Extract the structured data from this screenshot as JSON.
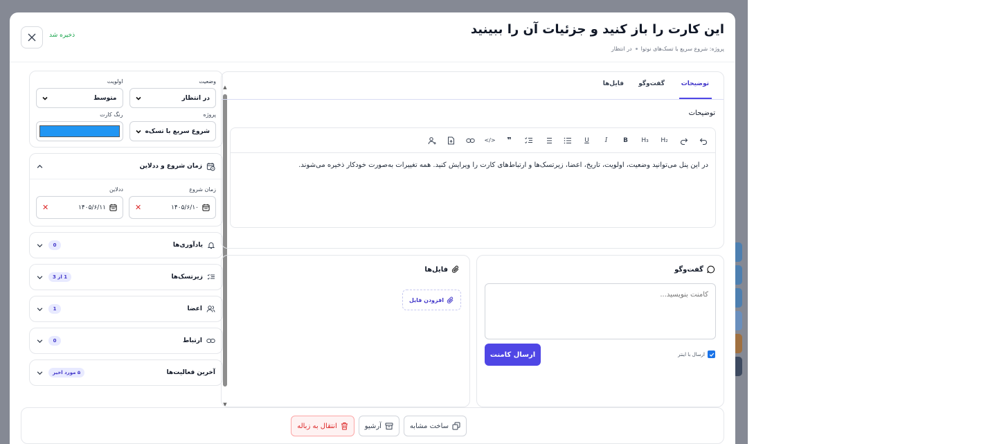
{
  "modal": {
    "title": "این کارت را باز کنید و جزئیات آن را ببینید",
    "breadcrumb": {
      "project": "پروژه: شروع سریع با تسک‌های نوتوا",
      "status": "در انتظار"
    },
    "saved_label": "ذخیره شد"
  },
  "props": {
    "status_label": "وضعیت",
    "status_value": "در انتظار",
    "priority_label": "اولویت",
    "priority_value": "متوسط",
    "project_label": "پروژه",
    "project_value": "شروع سریع با تسک‌ه",
    "color_label": "رنگ کارت",
    "color_value": "#2196f3"
  },
  "schedule": {
    "title": "زمان شروع و ددلاین",
    "start_label": "زمان شروع",
    "start_value": "۱۴۰۵/۶/۱۰",
    "deadline_label": "ددلاین",
    "deadline_value": "۱۴۰۵/۶/۱۱"
  },
  "sections": {
    "reminders": {
      "title": "یادآوری‌ها",
      "badge": "0"
    },
    "subtasks": {
      "title": "زیرتسک‌ها",
      "badge": "1 از 3"
    },
    "members": {
      "title": "اعضا",
      "badge": "1"
    },
    "links": {
      "title": "ارتباط",
      "badge": "0"
    },
    "activity": {
      "title": "آخرین فعالیت‌ها",
      "badge": "۵ مورد اخیر"
    }
  },
  "tabs": {
    "description": "توضیحات",
    "chat": "گفت‌وگو",
    "files": "فایل‌ها"
  },
  "description": {
    "section_title": "توضیحات",
    "body": "در این پنل می‌توانید وضعیت، اولویت، تاریخ، اعضا، زیرتسک‌ها و ارتباط‌های کارت را ویرایش کنید. همه تغییرات به‌صورت خودکار ذخیره می‌شوند."
  },
  "toolbar": {
    "h2": "H₂",
    "h3": "H₃"
  },
  "comments": {
    "title": "گفت‌وگو",
    "placeholder": "کامنت بنویسید...",
    "send_label": "ارسال کامنت",
    "enter_label": "ارسال با اینتر"
  },
  "files": {
    "title": "فایل‌ها",
    "add_label": "افزودن فایل"
  },
  "footer": {
    "duplicate": "ساخت مشابه",
    "archive": "آرشیو",
    "trash": "انتقال به زباله"
  },
  "colors": {
    "accent": "#4f46e5",
    "danger": "#dc2626",
    "success": "#16a34a",
    "card_color": "#2196f3"
  }
}
